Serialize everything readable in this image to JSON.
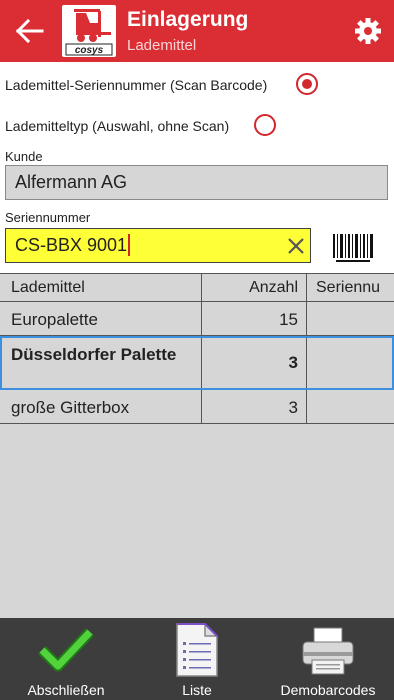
{
  "header": {
    "title": "Einlagerung",
    "subtitle": "Lademittel",
    "logo_text": "cosys",
    "back_icon": "arrow-left-icon",
    "settings_icon": "gear-icon"
  },
  "form": {
    "radio_serial_label": "Lademittel-Seriennummer (Scan Barcode)",
    "radio_serial_selected": true,
    "radio_type_label": "Lademitteltyp (Auswahl, ohne Scan)",
    "radio_type_selected": false,
    "customer_label": "Kunde",
    "customer_value": "Alfermann AG",
    "serial_label": "Seriennummer",
    "serial_value": "CS-BBX 9001"
  },
  "table": {
    "columns": [
      "Lademittel",
      "Anzahl",
      "Seriennu"
    ],
    "rows": [
      {
        "lademittel": "Europalette",
        "anzahl": "15",
        "serie": ""
      },
      {
        "lademittel": "Düsseldorfer Palette",
        "anzahl": "3",
        "serie": ""
      },
      {
        "lademittel": "große Gitterbox",
        "anzahl": "3",
        "serie": ""
      }
    ],
    "selected_row": 1
  },
  "bottom_bar": {
    "finish_label": "Abschließen",
    "list_label": "Liste",
    "demo_label": "Demobarcodes"
  },
  "colors": {
    "accent": "#db2d34",
    "active_field": "#ffff38",
    "selection": "#3d8fe0",
    "bottom_bar": "#3d3d3d"
  }
}
